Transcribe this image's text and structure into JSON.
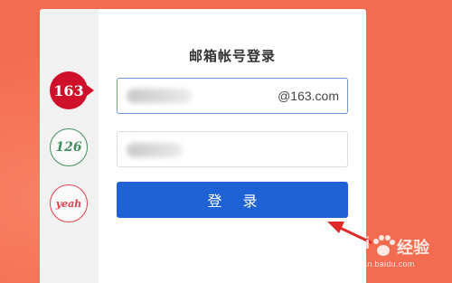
{
  "login": {
    "title": "邮箱帐号登录",
    "username": {
      "value": "",
      "suffix": "@163.com"
    },
    "password": {
      "value": ""
    },
    "submit_label": "登 录"
  },
  "brands": [
    {
      "label": "163",
      "selected": true,
      "color": "#d0102b"
    },
    {
      "label": "126",
      "selected": false,
      "color": "#3f8f5e"
    },
    {
      "label": "yeah",
      "selected": false,
      "color": "#e4404e"
    }
  ],
  "watermark": {
    "left_text": "Bai",
    "right_text": "经验",
    "url": "jingyan.baidu.com"
  },
  "colors": {
    "background": "#f36b50",
    "primary_button": "#1e62d5",
    "annotation_arrow": "#e02a2a"
  }
}
